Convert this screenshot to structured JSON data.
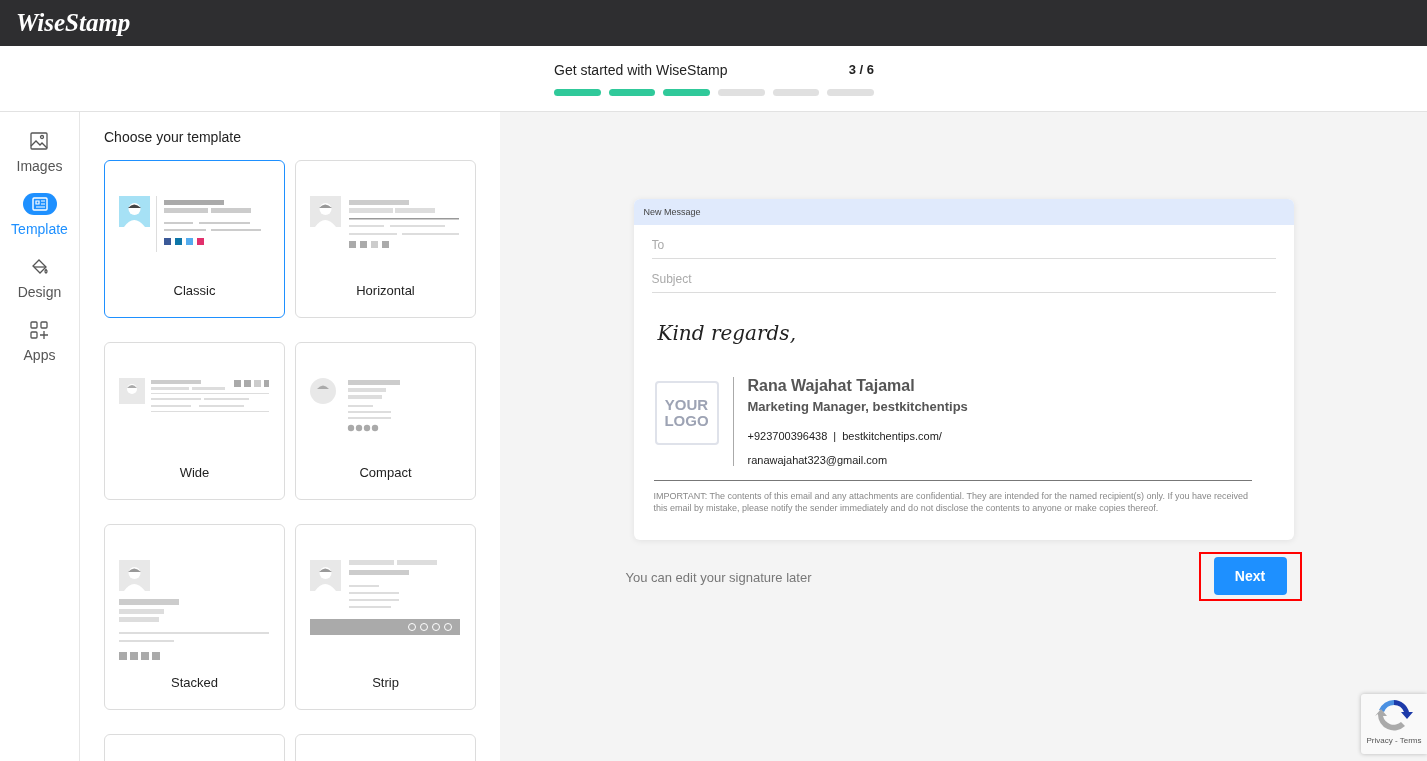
{
  "app": {
    "logo": "WiseStamp"
  },
  "onboarding": {
    "title": "Get started with WiseStamp",
    "counter": "3 / 6",
    "steps": [
      {
        "done": true
      },
      {
        "done": true
      },
      {
        "done": true
      },
      {
        "done": false
      },
      {
        "done": false
      },
      {
        "done": false
      }
    ]
  },
  "sidebar": {
    "items": [
      {
        "kind": "images",
        "label": "Images",
        "selected": false
      },
      {
        "kind": "template",
        "label": "Template",
        "selected": true
      },
      {
        "kind": "design",
        "label": "Design",
        "selected": false
      },
      {
        "kind": "apps",
        "label": "Apps",
        "selected": false
      }
    ]
  },
  "templates": {
    "heading": "Choose your template",
    "items": [
      {
        "kind": "classic",
        "name": "Classic",
        "selected": true
      },
      {
        "kind": "horizontal",
        "name": "Horizontal",
        "selected": false
      },
      {
        "kind": "wide",
        "name": "Wide",
        "selected": false
      },
      {
        "kind": "compact",
        "name": "Compact",
        "selected": false
      },
      {
        "kind": "stacked",
        "name": "Stacked",
        "selected": false
      },
      {
        "kind": "strip",
        "name": "Strip",
        "selected": false
      },
      {
        "kind": "cut",
        "selected": false
      },
      {
        "kind": "cut",
        "selected": false
      }
    ]
  },
  "preview": {
    "window_title": "New Message",
    "to_placeholder": "To",
    "subject_placeholder": "Subject",
    "closing": "Kind regards,",
    "logo_placeholder": "YOUR LOGO",
    "name": "Rana Wajahat Tajamal",
    "title": "Marketing Manager, bestkitchentips",
    "phone": "+923700396438",
    "separator": "|",
    "website": "bestkitchentips.com/",
    "email": "ranawajahat323@gmail.com",
    "disclaimer": "IMPORTANT: The contents of this email and any attachments are confidential. They are intended for the named recipient(s) only. If you have received this email by mistake, please notify the sender immediately and do not disclose the contents to anyone or make copies thereof."
  },
  "footer": {
    "note": "You can edit your signature later",
    "next_button": {
      "label": "Next",
      "highlighted": true
    }
  },
  "recaptcha": {
    "links": "Privacy - Terms"
  }
}
